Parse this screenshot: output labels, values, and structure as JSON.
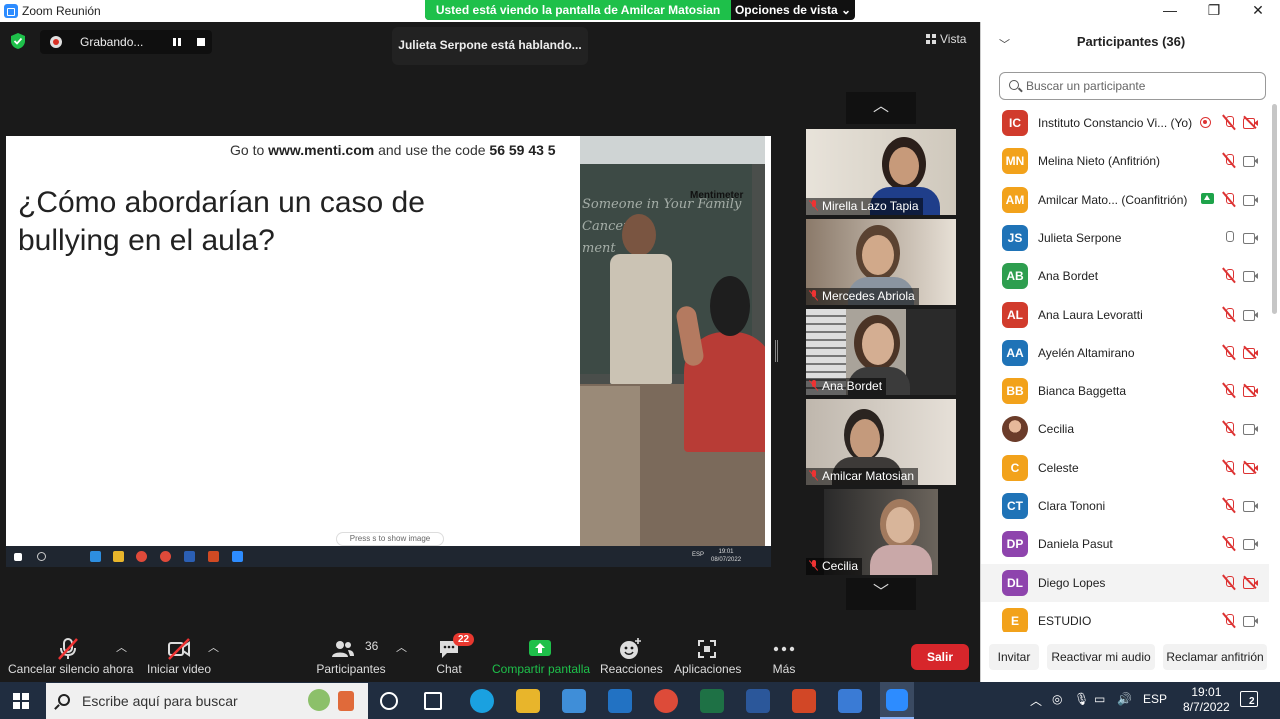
{
  "window": {
    "title": "Zoom Reunión",
    "minimize": "—",
    "maximize": "❐",
    "close": "✕"
  },
  "share_banner": {
    "text": "Usted está viendo la pantalla de Amilcar Matosian",
    "options": "Opciones de vista ⌄"
  },
  "recording": {
    "label": "Grabando..."
  },
  "speaking": "Julieta Serpone está hablando...",
  "view_label": "Vista",
  "shared_screen": {
    "code_prefix": "Go to",
    "site": "www.menti.com",
    "code_mid": "and use the code",
    "code": "56 59 43 5",
    "question": "¿Cómo abordarían un caso de bullying en el aula?",
    "brand": "Mentimeter",
    "chalk": "Someone in Your Family\nCancer\nment",
    "press_hint": "Press  s  to show image",
    "clock_time": "19:01",
    "clock_date": "08/07/2022",
    "lang": "ESP"
  },
  "gallery": [
    {
      "name": "Mirella Lazo Tapia"
    },
    {
      "name": "Mercedes Abriola"
    },
    {
      "name": "Ana Bordet"
    },
    {
      "name": "Amilcar Matosian"
    },
    {
      "name": "Cecilia"
    }
  ],
  "toolbar": {
    "mute": "Cancelar silencio ahora",
    "video": "Iniciar video",
    "participants": "Participantes",
    "participants_count": "36",
    "chat": "Chat",
    "chat_badge": "22",
    "share": "Compartir pantalla",
    "reactions": "Reacciones",
    "apps": "Aplicaciones",
    "more": "Más",
    "leave": "Salir"
  },
  "panel": {
    "title": "Participantes (36)",
    "search_placeholder": "Buscar un participante",
    "participants": [
      {
        "initials": "IC",
        "name": "Instituto Constancio Vi...  (Yo)",
        "color": "#d13b2c",
        "mic": "off",
        "cam": "off",
        "extra": "rec"
      },
      {
        "initials": "MN",
        "name": "Melina Nieto (Anfitrión)",
        "color": "#f2a21b",
        "mic": "off",
        "cam": "on"
      },
      {
        "initials": "AM",
        "name": "Amilcar Mato...  (Coanfitrión)",
        "color": "#f2a21b",
        "mic": "off",
        "cam": "on",
        "extra": "share"
      },
      {
        "initials": "JS",
        "name": "Julieta Serpone",
        "color": "#1f73b7",
        "mic": "on",
        "cam": "on"
      },
      {
        "initials": "AB",
        "name": "Ana Bordet",
        "color": "#2e9e4f",
        "mic": "off",
        "cam": "on"
      },
      {
        "initials": "AL",
        "name": "Ana Laura Levoratti",
        "color": "#d13b2c",
        "mic": "off",
        "cam": "on"
      },
      {
        "initials": "AA",
        "name": "Ayelén Altamirano",
        "color": "#1f73b7",
        "mic": "off",
        "cam": "off"
      },
      {
        "initials": "BB",
        "name": "Bianca Baggetta",
        "color": "#f2a21b",
        "mic": "off",
        "cam": "off"
      },
      {
        "initials": "",
        "name": "Cecilia",
        "color": "#8a5a4a",
        "mic": "off",
        "cam": "on"
      },
      {
        "initials": "C",
        "name": "Celeste",
        "color": "#f2a21b",
        "mic": "off",
        "cam": "off"
      },
      {
        "initials": "CT",
        "name": "Clara Tononi",
        "color": "#1f73b7",
        "mic": "off",
        "cam": "on"
      },
      {
        "initials": "DP",
        "name": "Daniela Pasut",
        "color": "#8e44ad",
        "mic": "off",
        "cam": "on"
      },
      {
        "initials": "DL",
        "name": "Diego Lopes",
        "color": "#8e44ad",
        "mic": "off",
        "cam": "off"
      },
      {
        "initials": "E",
        "name": "ESTUDIO",
        "color": "#f2a21b",
        "mic": "off",
        "cam": "on"
      }
    ],
    "buttons": {
      "invite": "Invitar",
      "unmute": "Reactivar mi audio",
      "claim": "Reclamar anfitrión"
    }
  },
  "taskbar": {
    "search_placeholder": "Escribe aquí para buscar",
    "time": "19:01",
    "date": "8/7/2022",
    "lang": "ESP",
    "notifications": "2"
  }
}
